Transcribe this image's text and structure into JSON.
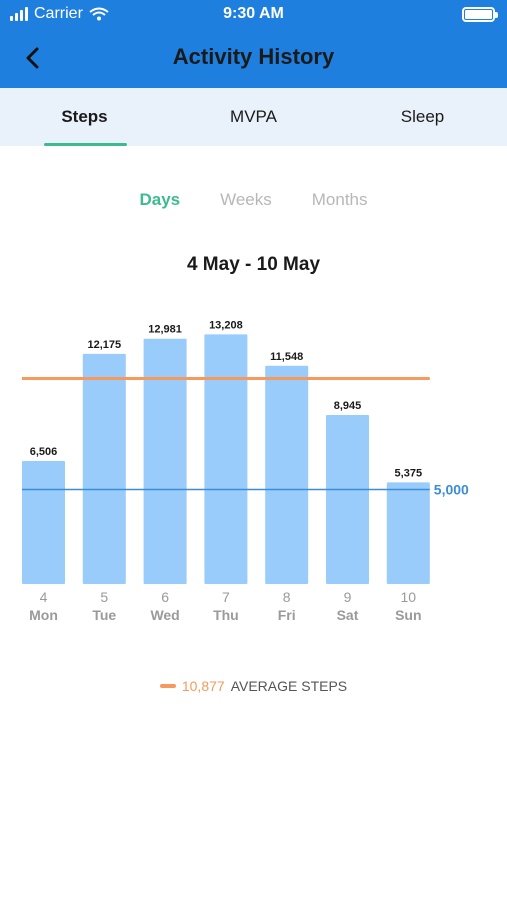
{
  "status_bar": {
    "carrier": "Carrier",
    "time": "9:30 AM"
  },
  "header": {
    "title": "Activity History",
    "back_icon": "chevron-left-icon"
  },
  "tabs": [
    {
      "label": "Steps",
      "active": true
    },
    {
      "label": "MVPA",
      "active": false
    },
    {
      "label": "Sleep",
      "active": false
    }
  ],
  "range_selector": [
    {
      "label": "Days",
      "active": true
    },
    {
      "label": "Weeks",
      "active": false
    },
    {
      "label": "Months",
      "active": false
    }
  ],
  "date_range": "4 May - 10 May",
  "colors": {
    "primary": "#1f7fde",
    "accent_green": "#3dbb8f",
    "bar": "#99ccfb",
    "average_line": "#f59a5c",
    "goal_line": "#3a8ed6"
  },
  "chart_data": {
    "type": "bar",
    "categories": [
      "4 Mon",
      "5 Tue",
      "6 Wed",
      "7 Thu",
      "8 Fri",
      "9 Sat",
      "10 Sun"
    ],
    "day_numbers": [
      "4",
      "5",
      "6",
      "7",
      "8",
      "9",
      "10"
    ],
    "day_names": [
      "Mon",
      "Tue",
      "Wed",
      "Thu",
      "Fri",
      "Sat",
      "Sun"
    ],
    "values": [
      6506,
      12175,
      12981,
      13208,
      11548,
      8945,
      5375
    ],
    "value_labels": [
      "6,506",
      "12,175",
      "12,981",
      "13,208",
      "11,548",
      "8,945",
      "5,375"
    ],
    "goal": 5000,
    "goal_label": "5,000",
    "average": 10877,
    "ylim": [
      0,
      14500
    ]
  },
  "legend": {
    "value": "10,877",
    "label": "AVERAGE STEPS"
  }
}
